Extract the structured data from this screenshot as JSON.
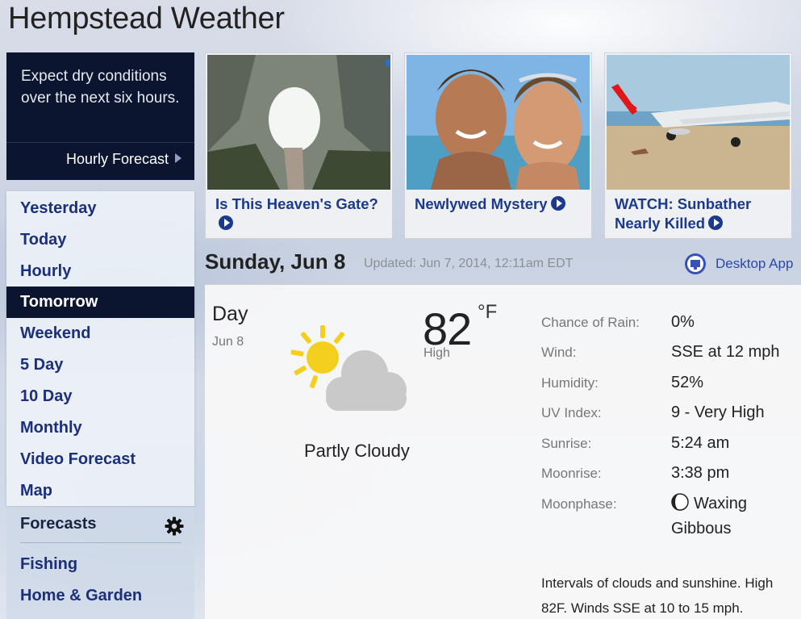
{
  "page": {
    "title": "Hempstead Weather"
  },
  "promo": {
    "text": "Expect dry conditions over the next six hours.",
    "link": "Hourly Forecast"
  },
  "nav": {
    "items": [
      "Yesterday",
      "Today",
      "Hourly",
      "Tomorrow",
      "Weekend",
      "5 Day",
      "10 Day",
      "Monthly",
      "Video Forecast",
      "Map"
    ],
    "active": "Tomorrow"
  },
  "forecasts": {
    "title": "Forecasts",
    "settings_icon": "gear-icon",
    "items": [
      "Fishing",
      "Home & Garden"
    ]
  },
  "tiles": [
    {
      "caption": "Is This Heaven's Gate?"
    },
    {
      "caption": "Newlywed Mystery"
    },
    {
      "caption": "WATCH: Sunbather Nearly Killed"
    }
  ],
  "main": {
    "date": "Sunday, Jun 8",
    "updated": "Updated: Jun 7, 2014, 12:11am EDT",
    "desktop_app": "Desktop App",
    "day_label": "Day",
    "day_date": "Jun 8",
    "temp": "82",
    "temp_unit": "°F",
    "temp_label": "High",
    "condition": "Partly Cloudy",
    "condition_icon": "partly-cloudy-icon",
    "stats": [
      {
        "label": "Chance of Rain:",
        "value": "0%"
      },
      {
        "label": "Wind:",
        "value": "SSE at 12 mph"
      },
      {
        "label": "Humidity:",
        "value": "52%"
      },
      {
        "label": "UV Index:",
        "value": "9 - Very High"
      },
      {
        "label": "Sunrise:",
        "value": "5:24 am"
      },
      {
        "label": "Moonrise:",
        "value": "3:38 pm"
      },
      {
        "label": "Moonphase:",
        "value_line1": "Waxing",
        "value_line2": "Gibbous",
        "icon": "moon-phase-icon"
      }
    ],
    "description": "Intervals of clouds and sunshine. High 82F. Winds SSE at 10 to 15 mph."
  },
  "colors": {
    "nav_link": "#1b2f7a",
    "dark_navy": "#0b1530",
    "tile_link": "#1b3a8c",
    "sun": "#f5cf1d",
    "cloud": "#c9c9c9"
  }
}
